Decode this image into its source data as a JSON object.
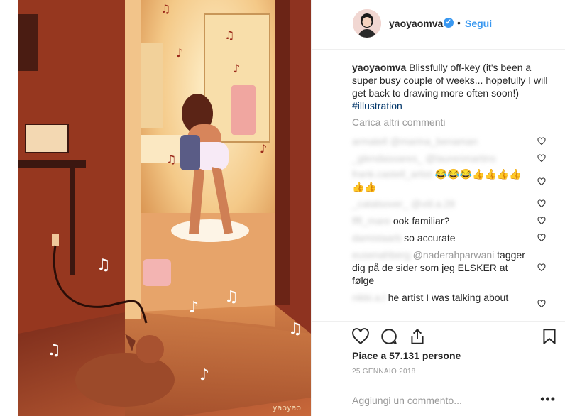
{
  "post": {
    "signature": "yaoyao"
  },
  "header": {
    "username": "yaoyaomva",
    "verified_mark": "✓",
    "separator": "•",
    "follow_label": "Segui"
  },
  "caption": {
    "username": "yaoyaomva",
    "text": "Blissfully off-key (it's been a super busy couple of weeks... hopefully I will get back to drawing more often soon!)",
    "hashtag": "#illustration"
  },
  "load_more_label": "Carica altri commenti",
  "comments": [
    {
      "username": "armatell",
      "text": "@marina_benaman",
      "blurred": true
    },
    {
      "username": "_glendasoares_",
      "text": "@laurenmartins",
      "blurred": true
    },
    {
      "username": "frank.castell_artist",
      "text": "😂😂😂👍👍👍👍👍👍",
      "blurred_user": true
    },
    {
      "username": "_catalsover_",
      "text": "@viil.a.28",
      "blurred": true
    },
    {
      "username": "fffl_mare",
      "text": "@damistaarb look familiar?",
      "visible_tail": "ook familiar?"
    },
    {
      "username": "damistaarb",
      "text": "@fffl_mare so accurate",
      "visible_tail": "so accurate"
    },
    {
      "username": "eusenahberg",
      "text": "@naderahparwani tagger dig på de sider som jeg ELSKER at følge",
      "mention": "@naderahparwani",
      "body": "tagger dig på de sider som jeg ELSKER at følge"
    },
    {
      "username": "nikki.a.l",
      "text": "@lyn the artist I was talking about",
      "visible_tail": "he artist I was talking about"
    }
  ],
  "actions": {
    "like_icon": "heart-icon",
    "comment_icon": "comment-icon",
    "share_icon": "share-icon",
    "save_icon": "bookmark-icon"
  },
  "likes_text": "Piace a 57.131 persone",
  "date_text": "25 GENNAIO 2018",
  "add_comment": {
    "placeholder": "Aggiungi un commento...",
    "more_label": "•••"
  },
  "colors": {
    "accent": "#3897f0",
    "muted": "#999999",
    "text": "#262626"
  }
}
